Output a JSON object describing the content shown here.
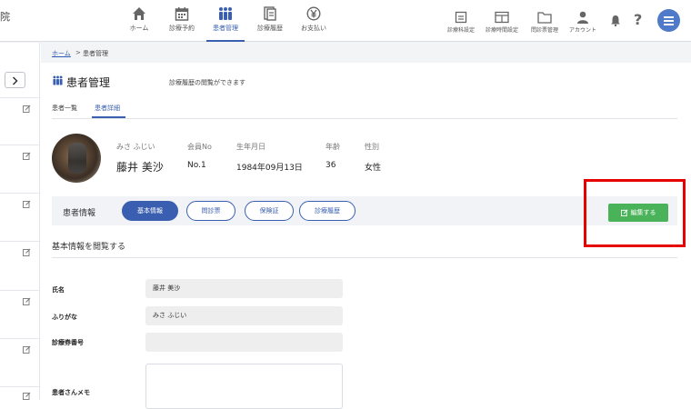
{
  "header": {
    "brand_fragment": "院",
    "nav": [
      {
        "label": "ホーム",
        "icon": "home-icon"
      },
      {
        "label": "診療予約",
        "icon": "calendar-icon"
      },
      {
        "label": "患者管理",
        "icon": "people-icon",
        "active": true
      },
      {
        "label": "診療履歴",
        "icon": "history-icon"
      },
      {
        "label": "お支払い",
        "icon": "yen-icon"
      }
    ],
    "utils": [
      {
        "label": "診療科設定",
        "icon": "department-icon"
      },
      {
        "label": "診療時間設定",
        "icon": "schedule-icon"
      },
      {
        "label": "問診票管理",
        "icon": "folder-icon"
      },
      {
        "label": "アカウント",
        "icon": "account-icon"
      }
    ],
    "bell_icon": "bell-icon",
    "help_label": "?",
    "menu_icon": "hamburger-menu-icon"
  },
  "breadcrumb": {
    "home": "ホーム",
    "separator": ">",
    "current": "患者管理"
  },
  "page": {
    "title": "患者管理",
    "subtitle": "診療履歴の閲覧ができます"
  },
  "tabs": [
    {
      "label": "患者一覧"
    },
    {
      "label": "患者詳細",
      "active": true
    }
  ],
  "patient": {
    "kana": "みさ ふじい",
    "name": "藤井 美沙",
    "member_no_label": "会員No",
    "member_no": "No.1",
    "birthdate_label": "生年月日",
    "birthdate": "1984年09月13日",
    "age_label": "年齢",
    "age": "36",
    "gender_label": "性別",
    "gender": "女性"
  },
  "info_bar": {
    "title": "患者情報",
    "pills": [
      {
        "label": "基本情報",
        "active": true
      },
      {
        "label": "問診票"
      },
      {
        "label": "保険証"
      },
      {
        "label": "診療履歴"
      }
    ],
    "edit_label": "編集する"
  },
  "section": {
    "title": "基本情報を閲覧する",
    "fields": [
      {
        "label": "氏名",
        "value": "藤井 美沙"
      },
      {
        "label": "ふりがな",
        "value": "みさ ふじい"
      },
      {
        "label": "診療券番号",
        "value": ""
      },
      {
        "label": "患者さんメモ",
        "value": ""
      }
    ]
  },
  "colors": {
    "accent": "#3a5fb0",
    "edit_button": "#4ab35a",
    "highlight": "#e60000"
  }
}
